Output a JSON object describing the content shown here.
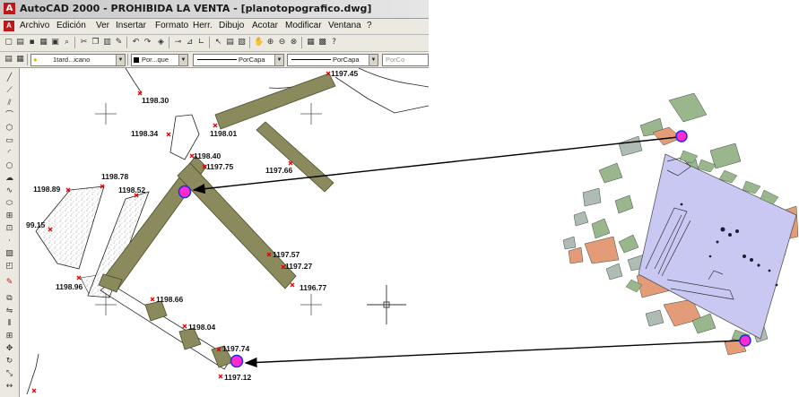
{
  "window": {
    "title": "AutoCAD 2000 - PROHIBIDA LA VENTA - [planotopografico.dwg]",
    "app_icon": "autocad-logo-icon",
    "doc_icon": "drawing-document-icon"
  },
  "menu": {
    "items": [
      "Archivo",
      "Edición",
      "Ver",
      "Insertar",
      "Formato",
      "Herr.",
      "Dibujo",
      "Acotar",
      "Modificar",
      "Ventana",
      "?"
    ]
  },
  "toolbar_layers": {
    "layer_value": "1tard...icano",
    "color_value": "Por...que",
    "linetype_value": "PorCapa",
    "lineweight_value": "PorCapa",
    "plotstyle_value": "PorCo"
  },
  "drawing": {
    "elevations": [
      "1197.45",
      "1198.30",
      "1198.34",
      "1198.01",
      "1198.40",
      "1197.75",
      "1197.66",
      "1198.78",
      "1198.89",
      "1198.52",
      "99.15",
      "1197.57",
      "1197.27",
      "1196.77",
      "1198.96",
      "1198.66",
      "1198.04",
      "1197.74",
      "1197.12"
    ]
  },
  "colors": {
    "wall_fill": "#8b8a5c",
    "wall_stroke": "#4c4b2e",
    "marker_red": "#e00000",
    "highlight_magenta": "#ff2bd0",
    "highlight_blue": "#1a2fe0",
    "photo_main": "#c9c8f3",
    "photo_green": "#9ab68c",
    "photo_orange": "#e39b78",
    "photo_gray": "#aebcb3"
  }
}
